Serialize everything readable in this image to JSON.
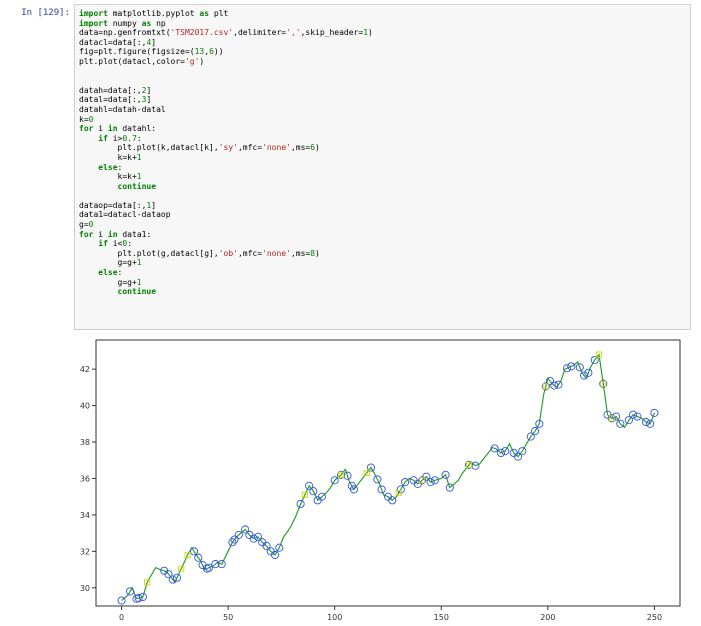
{
  "cell": {
    "prompt": "In [129]:",
    "code_lines": [
      [
        {
          "t": "import",
          "c": "kw"
        },
        {
          "t": " matplotlib.pyplot "
        },
        {
          "t": "as",
          "c": "kw"
        },
        {
          "t": " plt"
        }
      ],
      [
        {
          "t": "import",
          "c": "kw"
        },
        {
          "t": " numpy "
        },
        {
          "t": "as",
          "c": "kw"
        },
        {
          "t": " np"
        }
      ],
      [
        {
          "t": "data=np.genfromtxt("
        },
        {
          "t": "'TSM2017.csv'",
          "c": "str"
        },
        {
          "t": ",delimiter="
        },
        {
          "t": "','",
          "c": "str"
        },
        {
          "t": ",skip_header="
        },
        {
          "t": "1",
          "c": "num"
        },
        {
          "t": ")"
        }
      ],
      [
        {
          "t": "datacl=data[:,"
        },
        {
          "t": "4",
          "c": "num"
        },
        {
          "t": "]"
        }
      ],
      [
        {
          "t": "fig=plt.figure(figsize=("
        },
        {
          "t": "13",
          "c": "num"
        },
        {
          "t": ","
        },
        {
          "t": "6",
          "c": "num"
        },
        {
          "t": "))"
        }
      ],
      [
        {
          "t": "plt.plot(datacl,color="
        },
        {
          "t": "'g'",
          "c": "str"
        },
        {
          "t": ")"
        }
      ],
      [
        {
          "t": ""
        }
      ],
      [
        {
          "t": ""
        }
      ],
      [
        {
          "t": "datah=data[:,"
        },
        {
          "t": "2",
          "c": "num"
        },
        {
          "t": "]"
        }
      ],
      [
        {
          "t": "datal=data[:,"
        },
        {
          "t": "3",
          "c": "num"
        },
        {
          "t": "]"
        }
      ],
      [
        {
          "t": "datahl=datah-datal"
        }
      ],
      [
        {
          "t": "k="
        },
        {
          "t": "0",
          "c": "num"
        }
      ],
      [
        {
          "t": "for",
          "c": "kw"
        },
        {
          "t": " i "
        },
        {
          "t": "in",
          "c": "kw"
        },
        {
          "t": " datahl:"
        }
      ],
      [
        {
          "t": "    "
        },
        {
          "t": "if",
          "c": "kw"
        },
        {
          "t": " i>"
        },
        {
          "t": "0.7",
          "c": "num"
        },
        {
          "t": ":"
        }
      ],
      [
        {
          "t": "        plt.plot(k,datacl[k],"
        },
        {
          "t": "'sy'",
          "c": "str"
        },
        {
          "t": ",mfc="
        },
        {
          "t": "'none'",
          "c": "str"
        },
        {
          "t": ",ms="
        },
        {
          "t": "6",
          "c": "num"
        },
        {
          "t": ")"
        }
      ],
      [
        {
          "t": "        k=k+"
        },
        {
          "t": "1",
          "c": "num"
        }
      ],
      [
        {
          "t": "    "
        },
        {
          "t": "else",
          "c": "kw"
        },
        {
          "t": ":"
        }
      ],
      [
        {
          "t": "        k=k+"
        },
        {
          "t": "1",
          "c": "num"
        }
      ],
      [
        {
          "t": "        "
        },
        {
          "t": "continue",
          "c": "kw"
        }
      ],
      [
        {
          "t": ""
        }
      ],
      [
        {
          "t": "dataop=data[:,"
        },
        {
          "t": "1",
          "c": "num"
        },
        {
          "t": "]"
        }
      ],
      [
        {
          "t": "data1=datacl-dataop"
        }
      ],
      [
        {
          "t": "g="
        },
        {
          "t": "0",
          "c": "num"
        }
      ],
      [
        {
          "t": "for",
          "c": "kw"
        },
        {
          "t": " i "
        },
        {
          "t": "in",
          "c": "kw"
        },
        {
          "t": " data1:"
        }
      ],
      [
        {
          "t": "    "
        },
        {
          "t": "if",
          "c": "kw"
        },
        {
          "t": " i<"
        },
        {
          "t": "0",
          "c": "num"
        },
        {
          "t": ":"
        }
      ],
      [
        {
          "t": "        plt.plot(g,datacl[g],"
        },
        {
          "t": "'ob'",
          "c": "str"
        },
        {
          "t": ",mfc="
        },
        {
          "t": "'none'",
          "c": "str"
        },
        {
          "t": ",ms="
        },
        {
          "t": "8",
          "c": "num"
        },
        {
          "t": ")"
        }
      ],
      [
        {
          "t": "        g=g+"
        },
        {
          "t": "1",
          "c": "num"
        }
      ],
      [
        {
          "t": "    "
        },
        {
          "t": "else",
          "c": "kw"
        },
        {
          "t": ":"
        }
      ],
      [
        {
          "t": "        g=g+"
        },
        {
          "t": "1",
          "c": "num"
        }
      ],
      [
        {
          "t": "        "
        },
        {
          "t": "continue",
          "c": "kw"
        }
      ]
    ]
  },
  "colors": {
    "line": "#2ca02c",
    "down_marker": "#3355dd",
    "volatile_marker": "#d4d400",
    "prompt": "#303f9f",
    "code_bg": "#f7f7f7"
  },
  "chart_data": {
    "type": "line",
    "title": "",
    "xlabel": "",
    "ylabel": "",
    "xlim": [
      -12,
      262
    ],
    "ylim": [
      29.0,
      43.6
    ],
    "xticks": [
      0,
      50,
      100,
      150,
      200,
      250
    ],
    "yticks": [
      30,
      32,
      34,
      36,
      38,
      40,
      42
    ],
    "grid": false,
    "legend": false,
    "series": [
      {
        "name": "",
        "color": "#2ca02c",
        "anchors": [
          [
            0,
            29.3
          ],
          [
            3,
            29.6
          ],
          [
            5,
            30.0
          ],
          [
            7,
            29.4
          ],
          [
            10,
            29.5
          ],
          [
            12,
            30.3
          ],
          [
            14,
            30.7
          ],
          [
            16,
            31.1
          ],
          [
            18,
            31.0
          ],
          [
            21,
            30.9
          ],
          [
            23,
            30.6
          ],
          [
            25,
            30.3
          ],
          [
            27,
            30.8
          ],
          [
            29,
            31.3
          ],
          [
            31,
            31.8
          ],
          [
            33,
            32.2
          ],
          [
            35,
            31.8
          ],
          [
            37,
            31.5
          ],
          [
            39,
            31.0
          ],
          [
            41,
            31.1
          ],
          [
            43,
            31.2
          ],
          [
            45,
            31.4
          ],
          [
            47,
            31.3
          ],
          [
            50,
            32.0
          ],
          [
            52,
            32.5
          ],
          [
            54,
            32.8
          ],
          [
            56,
            33.0
          ],
          [
            58,
            33.2
          ],
          [
            60,
            32.9
          ],
          [
            62,
            32.7
          ],
          [
            64,
            32.8
          ],
          [
            66,
            32.5
          ],
          [
            68,
            32.3
          ],
          [
            70,
            32.0
          ],
          [
            72,
            31.8
          ],
          [
            74,
            32.2
          ],
          [
            76,
            32.8
          ],
          [
            78,
            33.1
          ],
          [
            80,
            33.5
          ],
          [
            82,
            34.0
          ],
          [
            84,
            34.6
          ],
          [
            86,
            35.1
          ],
          [
            88,
            35.6
          ],
          [
            90,
            35.3
          ],
          [
            92,
            34.8
          ],
          [
            94,
            35.0
          ],
          [
            96,
            35.2
          ],
          [
            98,
            35.5
          ],
          [
            100,
            35.9
          ],
          [
            103,
            36.2
          ],
          [
            105,
            36.5
          ],
          [
            107,
            35.8
          ],
          [
            109,
            35.4
          ],
          [
            111,
            35.7
          ],
          [
            113,
            36.0
          ],
          [
            115,
            36.3
          ],
          [
            117,
            36.6
          ],
          [
            119,
            36.2
          ],
          [
            121,
            35.7
          ],
          [
            123,
            35.1
          ],
          [
            125,
            35.0
          ],
          [
            127,
            34.8
          ],
          [
            129,
            35.0
          ],
          [
            131,
            35.4
          ],
          [
            133,
            35.8
          ],
          [
            135,
            36.0
          ],
          [
            137,
            35.9
          ],
          [
            139,
            35.7
          ],
          [
            141,
            35.9
          ],
          [
            143,
            36.1
          ],
          [
            145,
            35.8
          ],
          [
            147,
            35.9
          ],
          [
            150,
            36.0
          ],
          [
            152,
            36.2
          ],
          [
            154,
            35.5
          ],
          [
            156,
            35.7
          ],
          [
            158,
            35.9
          ],
          [
            160,
            36.3
          ],
          [
            162,
            36.6
          ],
          [
            164,
            36.9
          ],
          [
            166,
            36.7
          ],
          [
            168,
            36.8
          ],
          [
            170,
            37.1
          ],
          [
            172,
            37.4
          ],
          [
            174,
            37.7
          ],
          [
            176,
            37.6
          ],
          [
            178,
            37.4
          ],
          [
            180,
            37.5
          ],
          [
            182,
            37.9
          ],
          [
            184,
            37.4
          ],
          [
            186,
            37.2
          ],
          [
            188,
            37.5
          ],
          [
            190,
            37.9
          ],
          [
            192,
            38.3
          ],
          [
            194,
            38.6
          ],
          [
            196,
            39.0
          ],
          [
            198,
            40.6
          ],
          [
            200,
            41.5
          ],
          [
            202,
            41.2
          ],
          [
            204,
            41.0
          ],
          [
            206,
            41.3
          ],
          [
            208,
            42.0
          ],
          [
            210,
            42.1
          ],
          [
            212,
            42.2
          ],
          [
            214,
            42.4
          ],
          [
            216,
            41.8
          ],
          [
            218,
            41.5
          ],
          [
            220,
            42.1
          ],
          [
            222,
            42.5
          ],
          [
            224,
            42.8
          ],
          [
            226,
            41.2
          ],
          [
            228,
            39.5
          ],
          [
            230,
            39.3
          ],
          [
            232,
            39.4
          ],
          [
            234,
            39.0
          ],
          [
            236,
            38.8
          ],
          [
            238,
            39.2
          ],
          [
            240,
            39.5
          ],
          [
            242,
            39.4
          ],
          [
            244,
            39.3
          ],
          [
            246,
            39.1
          ],
          [
            248,
            39.0
          ],
          [
            250,
            39.6
          ]
        ]
      }
    ],
    "down_day_markers": [
      0,
      4,
      7,
      8,
      10,
      20,
      22,
      24,
      26,
      34,
      36,
      38,
      40,
      41,
      44,
      47,
      52,
      53,
      55,
      58,
      60,
      62,
      64,
      66,
      68,
      70,
      72,
      74,
      84,
      88,
      90,
      92,
      94,
      100,
      103,
      106,
      108,
      109,
      117,
      120,
      122,
      125,
      127,
      131,
      133,
      137,
      139,
      141,
      143,
      145,
      147,
      152,
      154,
      163,
      166,
      175,
      178,
      180,
      184,
      186,
      188,
      192,
      194,
      196,
      199,
      201,
      203,
      205,
      209,
      211,
      215,
      217,
      219,
      222,
      226,
      228,
      230,
      232,
      234,
      238,
      240,
      242,
      246,
      248,
      250
    ],
    "volatile_day_markers": [
      12,
      28,
      31,
      86,
      103,
      115,
      130,
      141,
      163,
      199,
      224,
      226,
      230
    ]
  }
}
